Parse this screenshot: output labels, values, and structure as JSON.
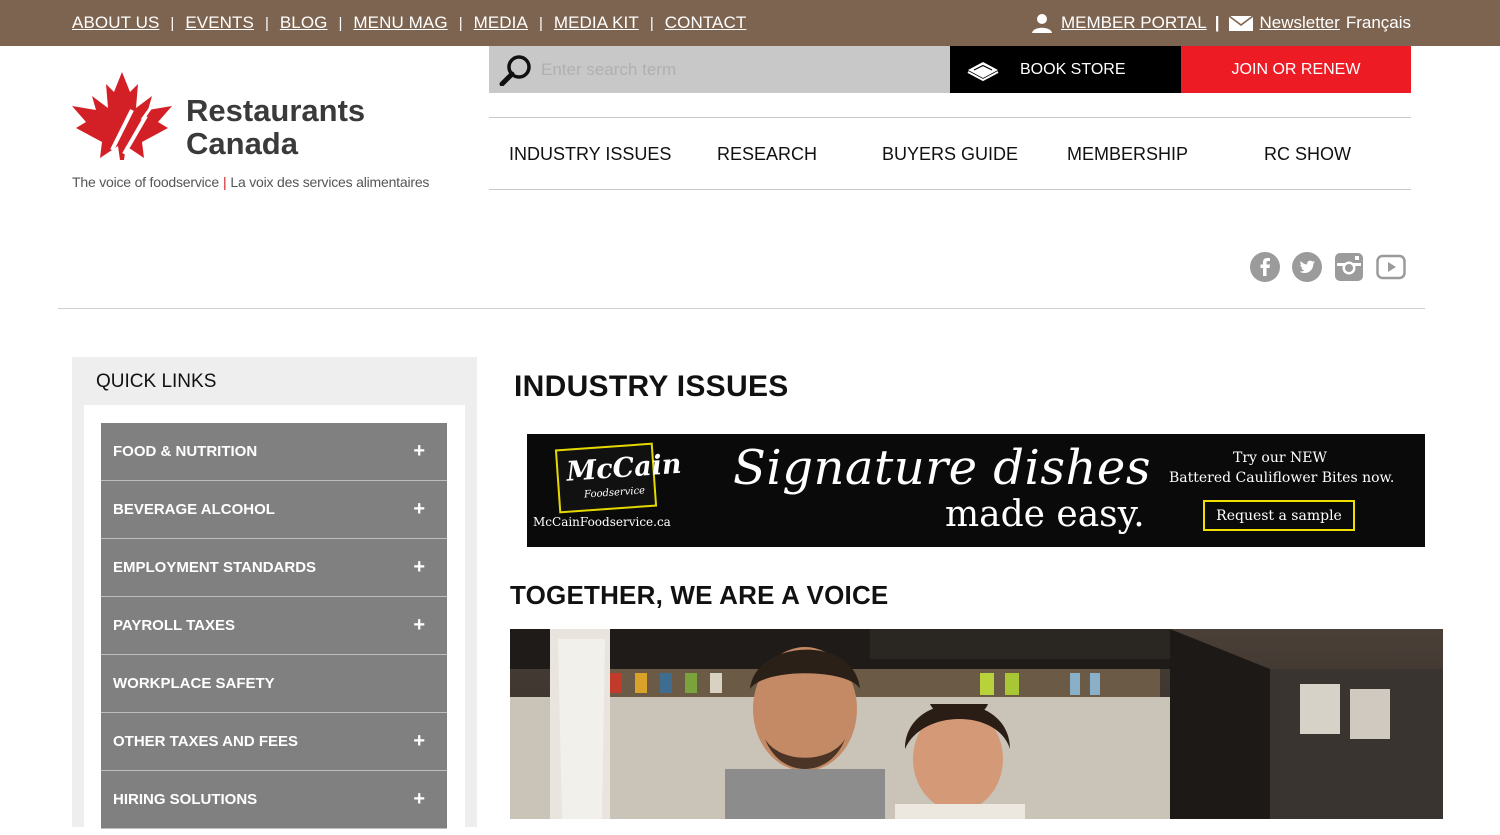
{
  "topnav": {
    "links": [
      "ABOUT US",
      "EVENTS",
      "BLOG",
      "MENU MAG",
      "MEDIA",
      "MEDIA KIT",
      "CONTACT"
    ],
    "separator": "|",
    "member_portal": "MEMBER PORTAL",
    "newsletter": "Newsletter",
    "language": "Français"
  },
  "logo": {
    "line1": "Restaurants",
    "line2": "Canada",
    "tagline_en": "The voice of foodservice",
    "tagline_fr": "La voix des services alimentaires"
  },
  "search": {
    "placeholder": "Enter search term"
  },
  "actions": {
    "book_store": "BOOK STORE",
    "join": "JOIN OR RENEW"
  },
  "mainnav": [
    "INDUSTRY ISSUES",
    "RESEARCH",
    "BUYERS GUIDE",
    "MEMBERSHIP",
    "RC SHOW"
  ],
  "social": [
    "facebook-icon",
    "twitter-icon",
    "instagram-icon",
    "youtube-icon"
  ],
  "quick_links": {
    "title": "QUICK LINKS",
    "items": [
      {
        "label": "FOOD & NUTRITION",
        "expand": "+"
      },
      {
        "label": "BEVERAGE ALCOHOL",
        "expand": "+"
      },
      {
        "label": "EMPLOYMENT STANDARDS",
        "expand": "+"
      },
      {
        "label": "PAYROLL TAXES",
        "expand": "+"
      },
      {
        "label": "WORKPLACE SAFETY",
        "expand": ""
      },
      {
        "label": "OTHER TAXES AND FEES",
        "expand": "+"
      },
      {
        "label": "HIRING SOLUTIONS",
        "expand": "+"
      }
    ]
  },
  "content": {
    "page_title": "INDUSTRY ISSUES",
    "ad": {
      "brand": "McCain",
      "brand_sub": "Foodservice",
      "url": "McCainFoodservice.ca",
      "headline1": "Signature dishes",
      "headline2": "made easy.",
      "try_line1": "Try our NEW",
      "try_line2": "Battered Cauliflower Bites now.",
      "cta": "Request a sample"
    },
    "section_title": "TOGETHER, WE ARE A VOICE"
  },
  "colors": {
    "topbar": "#7d6450",
    "join": "#ed1c24",
    "bookstore": "#000000",
    "quicklink_item": "#808080",
    "ad_border": "#f0e000"
  }
}
